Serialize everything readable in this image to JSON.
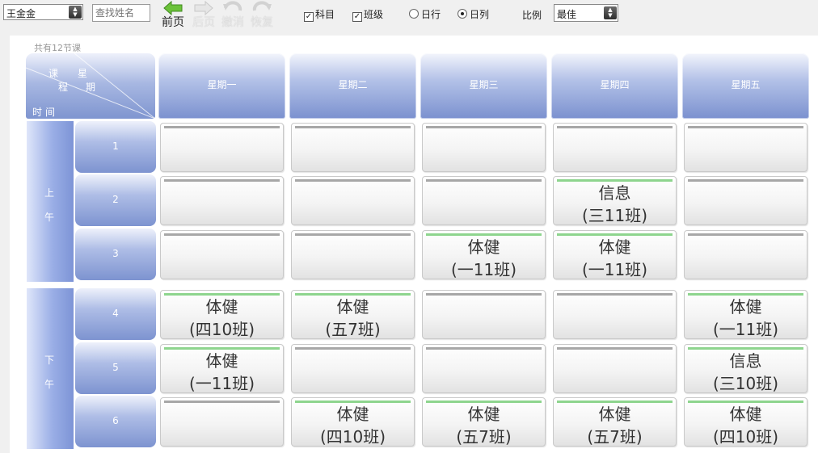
{
  "toolbar": {
    "teacher": "王金金",
    "search_placeholder": "查找姓名",
    "prev_label": "前页",
    "next_label": "后页",
    "undo_label": "撤消",
    "redo_label": "恢复",
    "subject_label": "科目",
    "class_label": "班级",
    "day_row_label": "日行",
    "day_col_label": "日列",
    "scale_label": "比例",
    "scale_value": "最佳",
    "subject_checked": true,
    "class_checked": true,
    "selected_layout": "日列"
  },
  "timetable": {
    "count": "共有12节课",
    "corner": {
      "a": "课",
      "b": "星",
      "c": "程",
      "d": "期",
      "e": "时",
      "f": "间"
    },
    "days": [
      "星期一",
      "星期二",
      "星期三",
      "星期四",
      "星期五"
    ],
    "halves": [
      {
        "c1": "上",
        "c2": "午"
      },
      {
        "c1": "下",
        "c2": "午"
      }
    ],
    "periods": [
      "1",
      "2",
      "3",
      "4",
      "5",
      "6"
    ],
    "rows": [
      [
        null,
        null,
        null,
        null,
        null
      ],
      [
        null,
        null,
        null,
        {
          "subject": "信息",
          "cls": "(三11班)"
        },
        null
      ],
      [
        null,
        null,
        {
          "subject": "体健",
          "cls": "(一11班)"
        },
        {
          "subject": "体健",
          "cls": "(一11班)"
        },
        null
      ],
      [
        {
          "subject": "体健",
          "cls": "(四10班)"
        },
        {
          "subject": "体健",
          "cls": "(五7班)"
        },
        null,
        null,
        {
          "subject": "体健",
          "cls": "(一11班)"
        }
      ],
      [
        {
          "subject": "体健",
          "cls": "(一11班)"
        },
        null,
        null,
        null,
        {
          "subject": "信息",
          "cls": "(三10班)"
        }
      ],
      [
        null,
        {
          "subject": "体健",
          "cls": "(四10班)"
        },
        {
          "subject": "体健",
          "cls": "(五7班)"
        },
        {
          "subject": "体健",
          "cls": "(五7班)"
        },
        {
          "subject": "体健",
          "cls": "(四10班)"
        }
      ]
    ]
  }
}
